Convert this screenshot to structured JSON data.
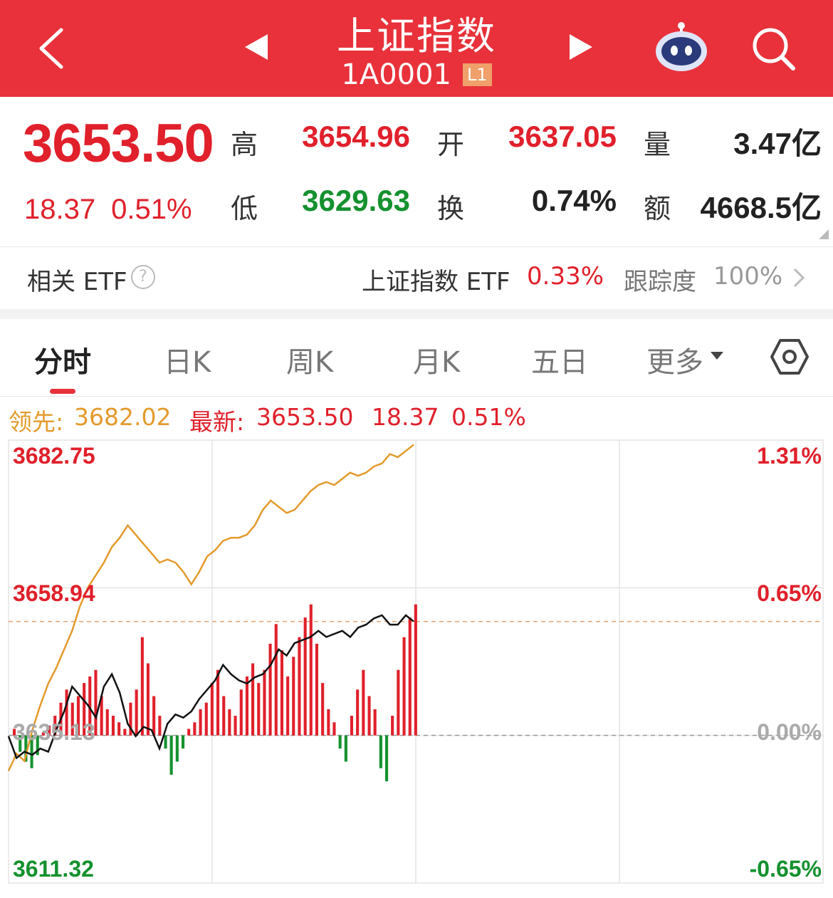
{
  "header": {
    "title": "上证指数",
    "code": "1A0001",
    "level_badge": "L1"
  },
  "quote": {
    "price": "3653.50",
    "change": "18.37",
    "change_pct": "0.51%",
    "high_label": "高",
    "high": "3654.96",
    "low_label": "低",
    "low": "3629.63",
    "open_label": "开",
    "open": "3637.05",
    "turnover_label": "换",
    "turnover": "0.74%",
    "volume_label": "量",
    "volume": "3.47亿",
    "amount_label": "额",
    "amount": "4668.5亿"
  },
  "etf": {
    "label": "相关 ETF",
    "help": "?",
    "name": "上证指数 ETF",
    "pct": "0.33%",
    "tracking_label": "跟踪度",
    "tracking_value": "100%"
  },
  "tabs": [
    {
      "label": "分时",
      "active": true
    },
    {
      "label": "日K"
    },
    {
      "label": "周K"
    },
    {
      "label": "月K"
    },
    {
      "label": "五日"
    },
    {
      "label": "更多"
    }
  ],
  "info_line": {
    "lead_label": "领先:",
    "lead_value": "3682.02",
    "latest_label": "最新:",
    "latest_value": "3653.50",
    "latest_change": "18.37",
    "latest_pct": "0.51%"
  },
  "colors": {
    "header": "#e8313a",
    "up": "#e0202b",
    "down": "#14912e",
    "lead_line": "#e39a2c",
    "price_line": "#111111"
  },
  "icons": [
    "chevron-left-icon",
    "triangle-left-icon",
    "triangle-right-icon",
    "robot-icon",
    "search-icon",
    "help-icon",
    "chevron-right-icon",
    "caret-down-icon",
    "settings-icon"
  ],
  "chart_data": {
    "type": "line",
    "y_labels_left": [
      "3682.75",
      "3658.94",
      "3635.13",
      "3611.32"
    ],
    "y_labels_right": [
      "1.31%",
      "0.65%",
      "0.00%",
      "-0.65%"
    ],
    "ylim": [
      3611.32,
      3682.75
    ],
    "prev_close": 3635.13,
    "time_fraction_elapsed": 0.5,
    "lead_series": [
      3629.4,
      3632.2,
      3631.0,
      3636.0,
      3640.0,
      3643.5,
      3646.0,
      3649.0,
      3652.0,
      3656.0,
      3659.0,
      3661.0,
      3663.0,
      3665.5,
      3667.0,
      3669.0,
      3667.5,
      3666.0,
      3664.5,
      3663.0,
      3663.5,
      3663.0,
      3661.5,
      3659.5,
      3661.5,
      3664.0,
      3665.0,
      3666.5,
      3667.0,
      3667.0,
      3667.5,
      3669.0,
      3671.5,
      3673.0,
      3672.0,
      3671.0,
      3671.5,
      3673.0,
      3674.5,
      3675.5,
      3676.0,
      3675.5,
      3676.5,
      3677.5,
      3677.0,
      3677.5,
      3678.5,
      3679.0,
      3680.5,
      3680.0,
      3681.0,
      3682.02
    ],
    "price_series": [
      3635.0,
      3631.5,
      3632.5,
      3632.0,
      3633.0,
      3632.5,
      3636.0,
      3639.0,
      3643.0,
      3641.5,
      3640.0,
      3638.0,
      3643.0,
      3645.0,
      3642.0,
      3637.0,
      3635.0,
      3636.5,
      3636.0,
      3633.0,
      3637.0,
      3638.5,
      3638.0,
      3639.0,
      3641.0,
      3642.5,
      3644.0,
      3646.5,
      3645.0,
      3644.0,
      3643.5,
      3644.5,
      3645.0,
      3646.5,
      3649.0,
      3648.0,
      3650.0,
      3650.5,
      3651.0,
      3652.0,
      3651.0,
      3651.5,
      3652.0,
      3651.0,
      3652.5,
      3653.0,
      3654.0,
      3654.5,
      3653.0,
      3653.0,
      3654.5,
      3653.5
    ],
    "flow_bars": [
      2,
      -5,
      -8,
      -10,
      -6,
      1,
      3,
      6,
      10,
      14,
      10,
      12,
      16,
      18,
      20,
      12,
      8,
      6,
      4,
      2,
      10,
      14,
      30,
      22,
      12,
      6,
      -4,
      -12,
      -8,
      -4,
      2,
      4,
      8,
      10,
      16,
      20,
      12,
      8,
      6,
      14,
      18,
      22,
      16,
      20,
      28,
      34,
      26,
      18,
      24,
      30,
      36,
      40,
      28,
      16,
      8,
      4,
      -4,
      -8,
      6,
      14,
      20,
      12,
      8,
      -10,
      -14,
      6,
      20,
      30,
      36,
      40
    ]
  }
}
